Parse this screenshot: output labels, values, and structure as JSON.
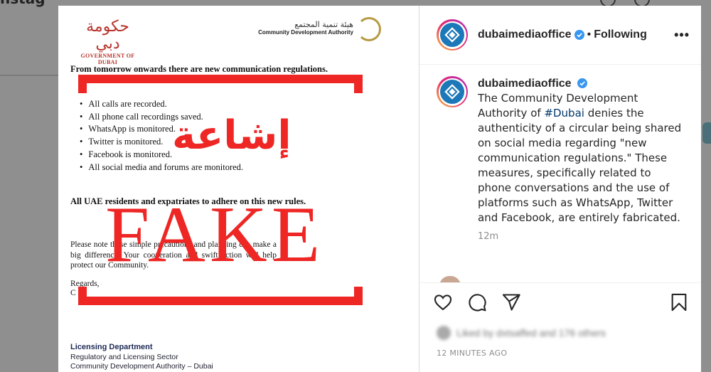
{
  "background": {
    "page_title": "nstag"
  },
  "post_image": {
    "gov_logo_ar": "حكومة دبي",
    "gov_logo_en": "GOVERNMENT OF DUBAI",
    "cda_logo_ar": "هيئة تنمية المجتمع",
    "cda_logo_en": "Community Development Authority",
    "heading": "From tomorrow onwards there are new communication regulations.",
    "list": [
      "All calls are recorded.",
      "All phone call recordings saved.",
      "WhatsApp is monitored.",
      "Twitter is monitored.",
      "Facebook is monitored.",
      "All social media and forums are monitored."
    ],
    "rule": "All UAE residents and expatriates to adhere on this new rules.",
    "paragraph": "Please note these simple precautions and planning can make a big difference. Your cooperation and swift action will help protect our Community.",
    "regards": "Regards,",
    "regards_sig": "C",
    "footer": {
      "line1": "Licensing Department",
      "line2": "Regulatory and Licensing Sector",
      "line3": "Community Development Authority – Dubai"
    },
    "stamp_ar": "إشاعة",
    "stamp_en": "FAKE",
    "stamp_color": "#ee2624"
  },
  "header": {
    "username": "dubaimediaoffice",
    "separator": "•",
    "follow_status": "Following",
    "more_label": "•••"
  },
  "caption": {
    "username": "dubaimediaoffice",
    "text_before": "The Community Development Authority of ",
    "hashtag": "#Dubai",
    "text_after": " denies the authenticity of a circular being shared on social media regarding \"new communication regulations.\" These measures, specifically related to phone conversations and the use of platforms such as WhatsApp, Twitter and Facebook, are entirely fabricated.",
    "time": "12m"
  },
  "actions": {
    "icons": [
      "heart-icon",
      "comment-icon",
      "share-icon",
      "bookmark-icon"
    ]
  },
  "likes": {
    "text": "Liked by dxtsaffed and 176 others"
  },
  "footer": {
    "time_ago": "12 MINUTES AGO"
  },
  "colors": {
    "accent_link": "#00376b",
    "verified": "#3897f0",
    "avatar_blue": "#1c78b8"
  }
}
